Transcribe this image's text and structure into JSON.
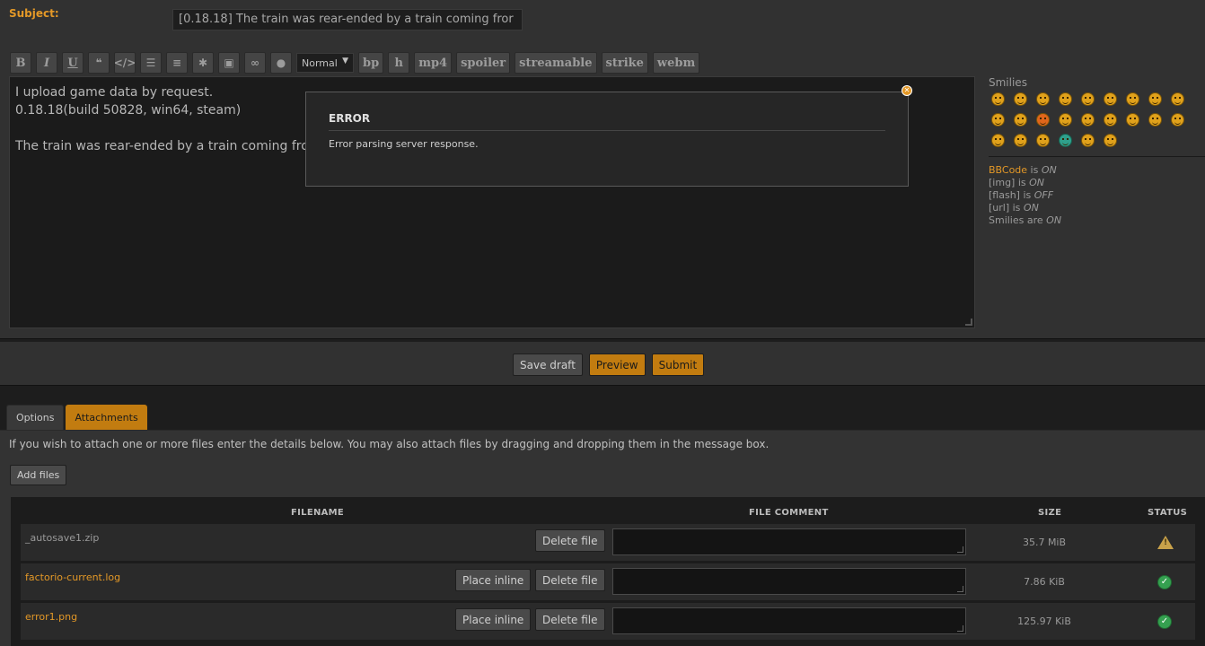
{
  "subject": {
    "label": "Subject:",
    "value": "[0.18.18] The train was rear-ended by a train coming fror"
  },
  "toolbar": {
    "bold": "B",
    "italic": "I",
    "underline": "U",
    "font_size_value": "Normal",
    "custom_tags": [
      "bp",
      "h",
      "mp4",
      "spoiler",
      "streamable",
      "strike",
      "webm"
    ]
  },
  "editor": {
    "lines": [
      "I upload game data by request.",
      "0.18.18(build 50828, win64, steam)",
      "",
      "The train was rear-ended by a train coming from"
    ]
  },
  "smilies": {
    "title": "Smilies"
  },
  "bbcode_status": {
    "bbcode_link": "BBCode",
    "bbcode_is": " is ",
    "bbcode_value": "ON",
    "img_label": "[img] is ",
    "img_value": "ON",
    "flash_label": "[flash] is ",
    "flash_value": "OFF",
    "url_label": "[url] is ",
    "url_value": "ON",
    "smilies_label": "Smilies are ",
    "smilies_value": "ON"
  },
  "error_dialog": {
    "title": "ERROR",
    "message": "Error parsing server response."
  },
  "actions": {
    "save_draft": "Save draft",
    "preview": "Preview",
    "submit": "Submit"
  },
  "tabs": {
    "options": "Options",
    "attachments": "Attachments"
  },
  "attachments": {
    "help_text": "If you wish to attach one or more files enter the details below. You may also attach files by dragging and dropping them in the message box.",
    "add_files": "Add files",
    "headers": {
      "filename": "FILENAME",
      "comment": "FILE COMMENT",
      "size": "SIZE",
      "status": "STATUS"
    },
    "place_inline": "Place inline",
    "delete_file": "Delete file",
    "files": [
      {
        "name": "_autosave1.zip",
        "size": "35.7 MiB",
        "status": "warning"
      },
      {
        "name": "factorio-current.log",
        "size": "7.86 KiB",
        "status": "ok"
      },
      {
        "name": "error1.png",
        "size": "125.97 KiB",
        "status": "ok"
      }
    ]
  },
  "colors": {
    "accent": "#e39827",
    "button_orange": "#c27c10",
    "panel": "#313131",
    "background": "#1d1d1d"
  }
}
